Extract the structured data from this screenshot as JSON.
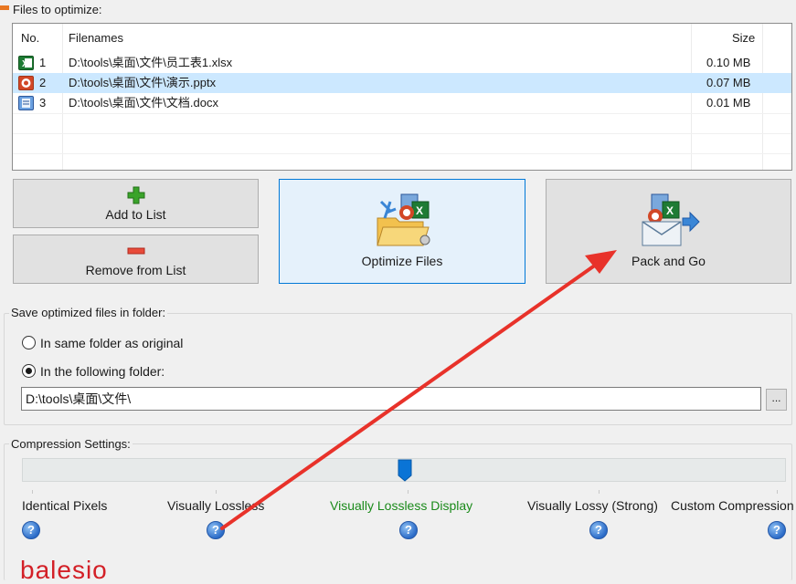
{
  "files_group": {
    "legend": "Files to optimize:"
  },
  "table": {
    "columns": {
      "no": "No.",
      "filename": "Filenames",
      "size": "Size"
    },
    "rows": [
      {
        "no": "1",
        "filename": "D:\\tools\\桌面\\文件\\员工表1.xlsx",
        "size": "0.10 MB",
        "icon": "excel-file-icon"
      },
      {
        "no": "2",
        "filename": "D:\\tools\\桌面\\文件\\演示.pptx",
        "size": "0.07 MB",
        "icon": "powerpoint-file-icon"
      },
      {
        "no": "3",
        "filename": "D:\\tools\\桌面\\文件\\文档.docx",
        "size": "0.01 MB",
        "icon": "word-file-icon"
      }
    ],
    "selected_row": 2
  },
  "buttons": {
    "add": "Add to List",
    "remove": "Remove from List",
    "optimize": "Optimize Files",
    "pack": "Pack and Go"
  },
  "save_group": {
    "legend": "Save optimized files in folder:",
    "option_same": "In same folder as original",
    "option_following": "In the following folder:",
    "selected": "following",
    "folder_path": "D:\\tools\\桌面\\文件\\",
    "browse": "..."
  },
  "compression_group": {
    "legend": "Compression Settings:",
    "levels": [
      {
        "label": "Identical Pixels"
      },
      {
        "label": "Visually Lossless"
      },
      {
        "label": "Visually Lossless Display"
      },
      {
        "label": "Visually Lossy (Strong)"
      },
      {
        "label": "Custom Compression"
      }
    ],
    "selected_level": 3,
    "help_glyph": "?"
  },
  "colors": {
    "accent": "#0078d7",
    "selected_row": "#cce8ff",
    "active_level": "#1a8a1a",
    "annotation_arrow": "#e8322a",
    "logo": "#d32027"
  },
  "logo_text": "balesio"
}
